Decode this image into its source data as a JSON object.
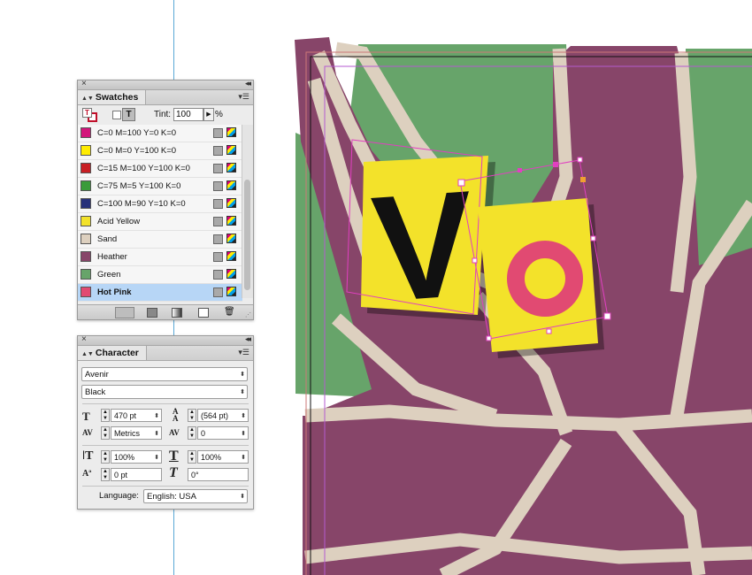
{
  "swatches_panel": {
    "tab_label": "Swatches",
    "tint_label": "Tint:",
    "tint_value": "100",
    "tint_unit": "%",
    "swatches": [
      {
        "name": "C=0 M=100 Y=0 K=0",
        "color": "#d3157b",
        "selected": false
      },
      {
        "name": "C=0 M=0 Y=100 K=0",
        "color": "#ffec00",
        "selected": false
      },
      {
        "name": "C=15 M=100 Y=100 K=0",
        "color": "#c81e23",
        "selected": false
      },
      {
        "name": "C=75 M=5 Y=100 K=0",
        "color": "#3a9b3a",
        "selected": false
      },
      {
        "name": "C=100 M=90 Y=10 K=0",
        "color": "#27317a",
        "selected": false
      },
      {
        "name": "Acid Yellow",
        "color": "#f3e22a",
        "selected": false
      },
      {
        "name": "Sand",
        "color": "#ddd0bf",
        "selected": false
      },
      {
        "name": "Heather",
        "color": "#874569",
        "selected": false
      },
      {
        "name": "Green",
        "color": "#67a46a",
        "selected": false
      },
      {
        "name": "Hot Pink",
        "color": "#e14a72",
        "selected": true
      }
    ]
  },
  "character_panel": {
    "tab_label": "Character",
    "font_family": "Avenir",
    "font_style": "Black",
    "font_size": "470 pt",
    "leading": "(564 pt)",
    "kerning": "Metrics",
    "tracking": "0",
    "vertical_scale": "100%",
    "horizontal_scale": "100%",
    "baseline_shift": "0 pt",
    "skew": "0°",
    "language_label": "Language:",
    "language_value": "English: USA"
  },
  "artwork": {
    "letter_v": "V",
    "letter_o": "O",
    "colors": {
      "heather": "#874569",
      "sand": "#ddd0bf",
      "green": "#67a46a",
      "acid_yellow": "#f3e22a",
      "hot_pink": "#e14a72",
      "selection": "#e040c0",
      "guide": "#5aa9d6"
    }
  }
}
